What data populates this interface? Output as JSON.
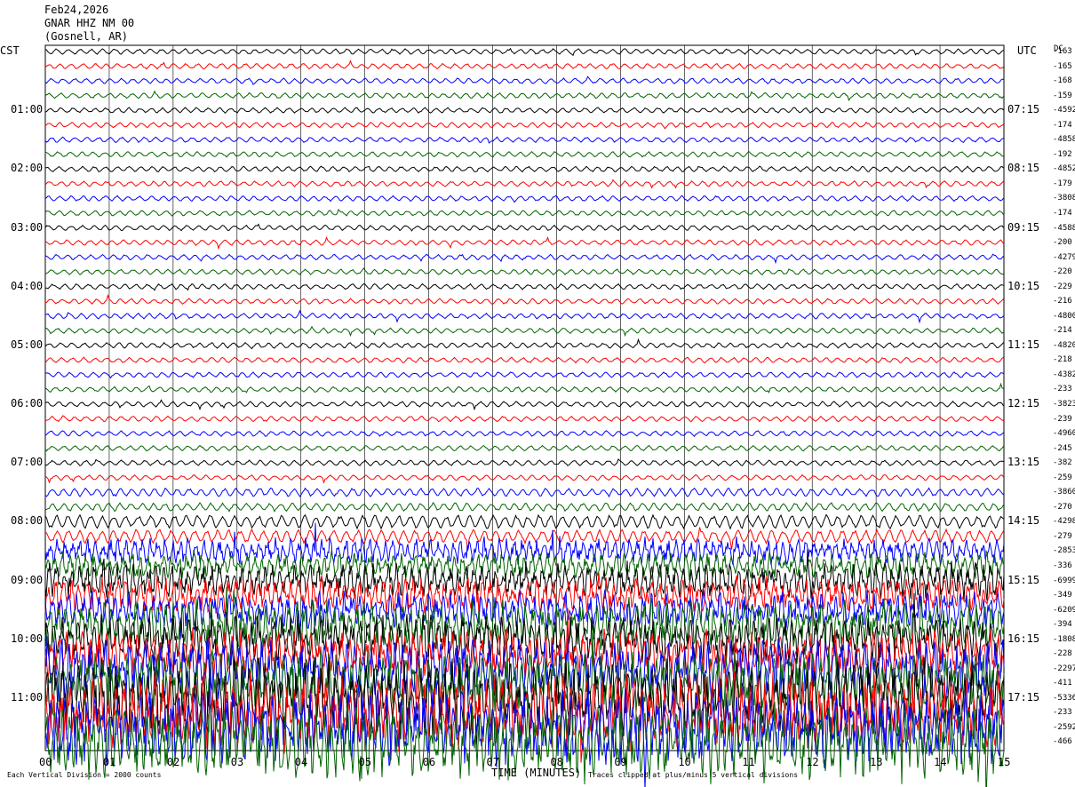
{
  "header": {
    "date": "Feb24,2026",
    "station": "GNAR HHZ NM 00",
    "location": "(Gosnell, AR)"
  },
  "left_tz": "CST",
  "right_tz": "UTC",
  "dc_header": "DC",
  "colors": {
    "trace_cycle": [
      "#000000",
      "#ff0000",
      "#0000ff",
      "#006400"
    ],
    "grid": "#000000",
    "background": "#ffffff"
  },
  "chart_data": {
    "type": "line",
    "title": "",
    "xlabel": "TIME (MINUTES)",
    "x_ticks": [
      "00",
      "01",
      "02",
      "03",
      "04",
      "05",
      "06",
      "07",
      "08",
      "09",
      "10",
      "11",
      "12",
      "13",
      "14",
      "15"
    ],
    "xlim": [
      0,
      15
    ],
    "rows_per_hour": 4,
    "left_hour_labels": [
      "01:00",
      "02:00",
      "03:00",
      "04:00",
      "05:00",
      "06:00",
      "07:00",
      "08:00",
      "09:00",
      "10:00",
      "11:00"
    ],
    "right_hour_labels": [
      "07:15",
      "08:15",
      "09:15",
      "10:15",
      "11:15",
      "12:15",
      "13:15",
      "14:15",
      "15:15",
      "16:15",
      "17:15"
    ],
    "dc_offsets": [
      "-163",
      "-165",
      "-168",
      "-159",
      "-4592",
      "-174",
      "-4858",
      "-192",
      "-4852",
      "-179",
      "-3808",
      "-174",
      "-4588",
      "-200",
      "-4279",
      "-220",
      "-229",
      "-216",
      "-4800",
      "-214",
      "-4820",
      "-218",
      "-4382",
      "-233",
      "-3823",
      "-239",
      "-4960",
      "-245",
      "-382",
      "-259",
      "-3860",
      "-270",
      "-4298",
      "-279",
      "-2853",
      "-336",
      "-6999",
      "-349",
      "-6209",
      "-394",
      "-1808",
      "-228",
      "-2297",
      "-411",
      "-5336",
      "-233",
      "-2592",
      "-466"
    ],
    "row_amplitude_level": [
      1,
      1,
      1,
      1,
      1,
      1,
      1,
      1,
      1,
      1,
      1,
      1,
      1,
      1,
      1,
      1,
      1,
      1,
      1,
      1,
      1,
      1,
      1,
      1,
      1,
      1,
      1,
      1,
      1,
      1,
      2,
      2,
      3,
      3,
      4,
      4,
      5,
      5,
      5,
      6,
      6,
      6,
      7,
      7,
      8,
      8,
      8,
      8
    ],
    "clipping_note": "Traces clipped at plus/minus 5 vertical divisions",
    "scale_note": "Each Vertical Division = 2000 counts"
  }
}
